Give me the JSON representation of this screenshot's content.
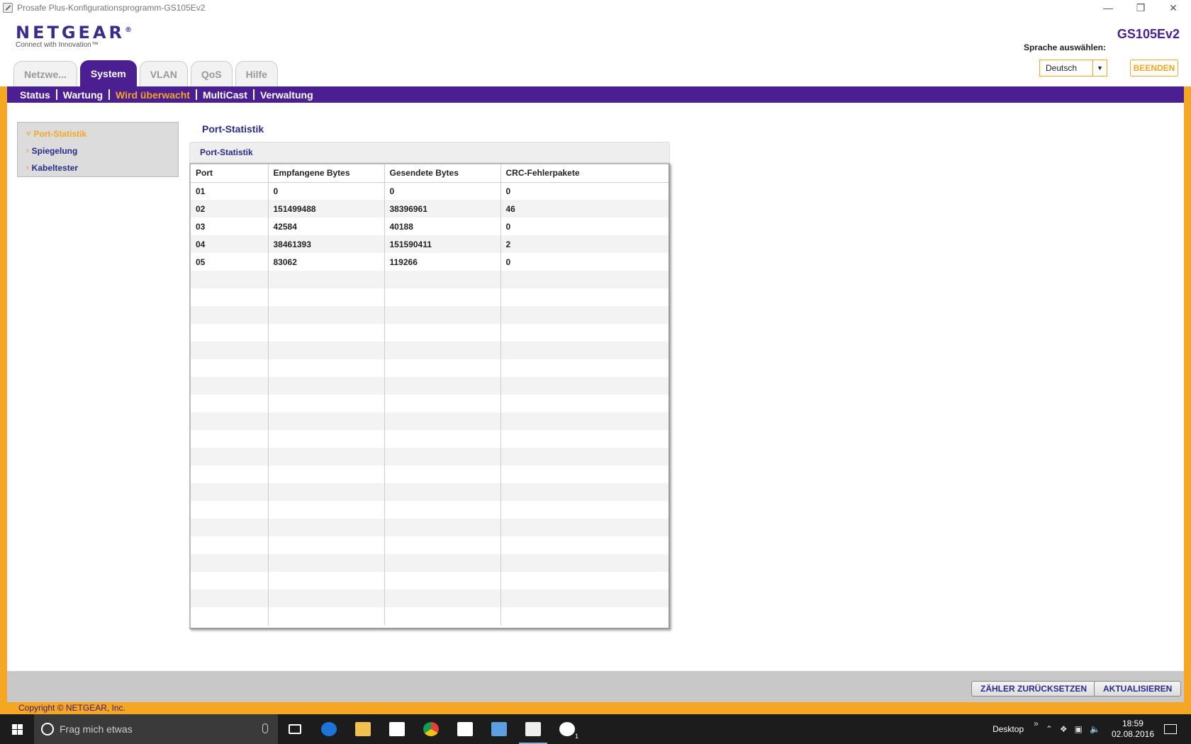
{
  "window": {
    "title": "Prosafe Plus-Konfigurationsprogramm-GS105Ev2",
    "minimize": "—",
    "restore": "❒",
    "close": "✕"
  },
  "header": {
    "brand": "NETGEAR",
    "trademark": "®",
    "tagline": "Connect with Innovation™",
    "model": "GS105Ev2",
    "language_label": "Sprache auswählen:",
    "language_value": "Deutsch",
    "exit_label": "BEENDEN"
  },
  "tabs": [
    {
      "label": "Netzwe...",
      "active": false
    },
    {
      "label": "System",
      "active": true
    },
    {
      "label": "VLAN",
      "active": false
    },
    {
      "label": "QoS",
      "active": false
    },
    {
      "label": "Hilfe",
      "active": false
    }
  ],
  "subnav": [
    {
      "label": "Status",
      "active": false
    },
    {
      "label": "Wartung",
      "active": false
    },
    {
      "label": "Wird überwacht",
      "active": true
    },
    {
      "label": "MultiCast",
      "active": false
    },
    {
      "label": "Verwaltung",
      "active": false
    }
  ],
  "sidemenu": [
    {
      "label": "Port-Statistik",
      "bullet": "˅",
      "active": true
    },
    {
      "label": "Spiegelung",
      "bullet": "›",
      "active": false
    },
    {
      "label": "Kabeltester",
      "bullet": "›",
      "active": false
    }
  ],
  "content": {
    "page_title": "Port-Statistik",
    "panel_title": "Port-Statistik",
    "columns": [
      "Port",
      "Empfangene Bytes",
      "Gesendete Bytes",
      "CRC-Fehlerpakete"
    ],
    "rows": [
      [
        "01",
        "0",
        "0",
        "0"
      ],
      [
        "02",
        "151499488",
        "38396961",
        "46"
      ],
      [
        "03",
        "42584",
        "40188",
        "0"
      ],
      [
        "04",
        "38461393",
        "151590411",
        "2"
      ],
      [
        "05",
        "83062",
        "119266",
        "0"
      ]
    ]
  },
  "footer": {
    "reset_label": "ZÄHLER ZURÜCKSETZEN",
    "refresh_label": "AKTUALISIEREN",
    "copyright": "Copyright © NETGEAR, Inc."
  },
  "taskbar": {
    "search_placeholder": "Frag mich etwas",
    "desktop_label": "Desktop",
    "chevron": "»",
    "time": "18:59",
    "date": "02.08.2016",
    "xbox_badge": "1"
  },
  "colors": {
    "brand_purple": "#4b1e91",
    "accent_orange": "#f5a623"
  }
}
